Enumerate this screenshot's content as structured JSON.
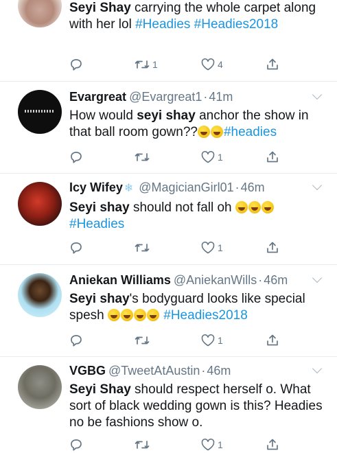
{
  "tweets": [
    {
      "name": "Seyi Shay",
      "text_parts": [
        {
          "t": " carrying the whole carpet along with her lol ",
          "c": ""
        },
        {
          "t": "#Headies",
          "c": "hashtag"
        },
        {
          "t": " ",
          "c": ""
        },
        {
          "t": "#Headies2018",
          "c": "hashtag"
        }
      ],
      "reply_count": "",
      "retweet_count": "1",
      "like_count": "4"
    },
    {
      "name": "Evargreat",
      "handle": "@Evargreat1",
      "time": "41m",
      "text_parts": [
        {
          "t": "How would ",
          "c": ""
        },
        {
          "t": "seyi shay",
          "c": "bold"
        },
        {
          "t": " anchor the show in that ball room gown??",
          "c": ""
        },
        {
          "t": "2",
          "c": "emoji"
        },
        {
          "t": "#headies",
          "c": "hashtag"
        }
      ],
      "reply_count": "",
      "retweet_count": "",
      "like_count": "1"
    },
    {
      "name": "Icy Wifey",
      "handle": "@MagicianGirl01",
      "time": "46m",
      "text_parts": [
        {
          "t": "Seyi shay",
          "c": "bold"
        },
        {
          "t": " should not fall oh ",
          "c": ""
        },
        {
          "t": "3",
          "c": "emoji"
        },
        {
          "t": "#Headies",
          "c": "hashtag"
        }
      ],
      "reply_count": "",
      "retweet_count": "",
      "like_count": "1"
    },
    {
      "name": "Aniekan Williams",
      "handle": "@AniekanWills",
      "time": "46m",
      "text_parts": [
        {
          "t": "Seyi shay",
          "c": "bold"
        },
        {
          "t": "'s bodyguard looks like special spesh ",
          "c": ""
        },
        {
          "t": "4",
          "c": "emoji"
        },
        {
          "t": "#Headies2018",
          "c": "hashtag"
        }
      ],
      "reply_count": "",
      "retweet_count": "",
      "like_count": "1"
    },
    {
      "name": "VGBG",
      "handle": "@TweetAtAustin",
      "time": "46m",
      "text_parts": [
        {
          "t": "Seyi Shay",
          "c": "bold"
        },
        {
          "t": " should respect herself o. What sort of black wedding gown is this? Headies no be fashions show o.",
          "c": ""
        }
      ],
      "reply_count": "",
      "retweet_count": "",
      "like_count": "1"
    }
  ],
  "colors": {
    "text": "#14171a",
    "secondary": "#657786",
    "link": "#1b95e0",
    "divider": "#e6ecf0"
  },
  "icons": [
    "reply-icon",
    "retweet-icon",
    "like-icon",
    "share-icon",
    "chevron-down-icon",
    "snowflake-icon",
    "laughing-emoji"
  ]
}
